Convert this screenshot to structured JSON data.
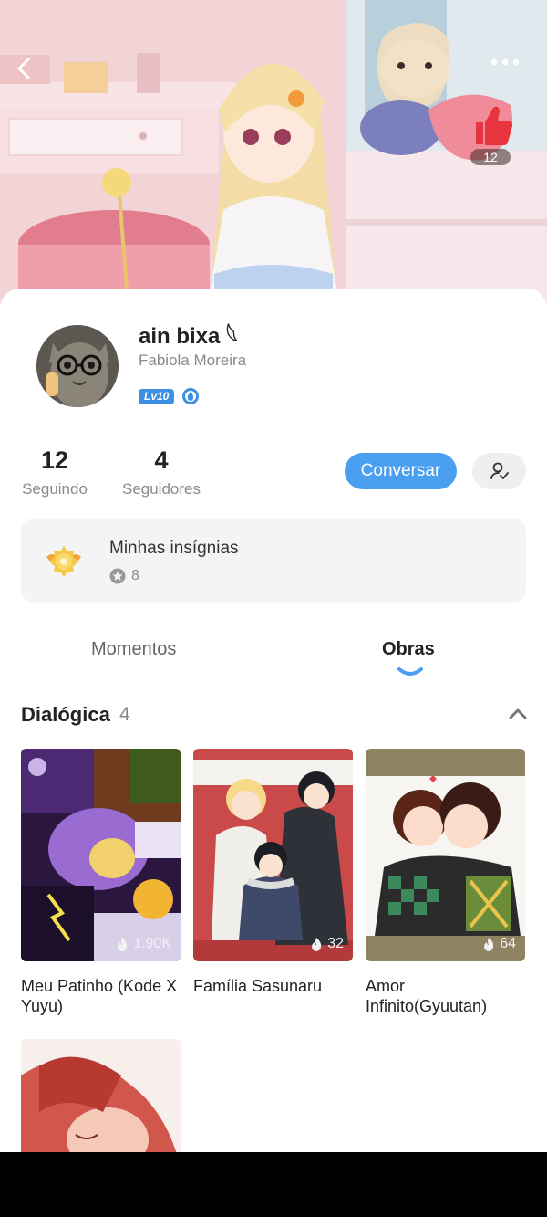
{
  "header": {
    "like_count": "12"
  },
  "profile": {
    "name": "ain bixa 𓆩",
    "subname": "Fabiola Moreira",
    "level": "Lv10"
  },
  "stats": {
    "following_num": "12",
    "following_label": "Seguindo",
    "followers_num": "4",
    "followers_label": "Seguidores"
  },
  "actions": {
    "chat_label": "Conversar"
  },
  "badges": {
    "title": "Minhas insígnias",
    "count": "8"
  },
  "tabs": [
    {
      "label": "Momentos",
      "active": false
    },
    {
      "label": "Obras",
      "active": true
    }
  ],
  "section": {
    "title": "Dialógica",
    "count": "4"
  },
  "works": [
    {
      "title": "Meu Patinho (Kode X Yuyu)",
      "heat": "1.90K"
    },
    {
      "title": "Família Sasunaru",
      "heat": "32"
    },
    {
      "title": "Amor Infinito(Gyuutan)",
      "heat": "64"
    },
    {
      "title": "",
      "heat": ""
    }
  ],
  "colors": {
    "accent": "#4a9ff0",
    "level_badge": "#3d8fe6",
    "like_red": "#e8343f"
  }
}
